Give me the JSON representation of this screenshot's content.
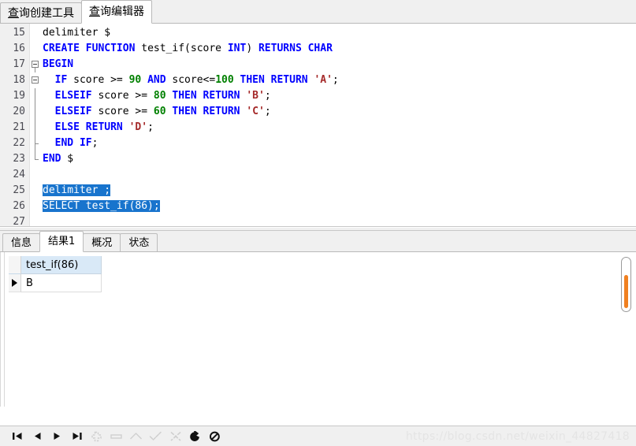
{
  "top_tabs": [
    {
      "label": "查询创建工具",
      "mnemonic": "查",
      "rest": "询创建工具",
      "active": false
    },
    {
      "label": "查询编辑器",
      "mnemonic": "查",
      "rest": "询编辑器",
      "active": true
    }
  ],
  "editor": {
    "first_line_number": 15,
    "lines": [
      {
        "n": "15",
        "fold": "none",
        "text": "delimiter $"
      },
      {
        "n": "16",
        "fold": "none",
        "text": "CREATE FUNCTION test_if(score INT) RETURNS CHAR"
      },
      {
        "n": "17",
        "fold": "open",
        "text": "BEGIN"
      },
      {
        "n": "18",
        "fold": "open2",
        "text": "  IF score >= 90 AND score<=100 THEN RETURN 'A';"
      },
      {
        "n": "19",
        "fold": "bar",
        "text": "  ELSEIF score >= 80 THEN RETURN 'B';"
      },
      {
        "n": "20",
        "fold": "bar",
        "text": "  ELSEIF score >= 60 THEN RETURN 'C';"
      },
      {
        "n": "21",
        "fold": "bar",
        "text": "  ELSE RETURN 'D';"
      },
      {
        "n": "22",
        "fold": "endin",
        "text": "  END IF;"
      },
      {
        "n": "23",
        "fold": "end",
        "text": "END $"
      },
      {
        "n": "24",
        "fold": "none",
        "text": ""
      },
      {
        "n": "25",
        "fold": "none",
        "text": "delimiter ;",
        "selected": true
      },
      {
        "n": "26",
        "fold": "none",
        "text": "SELECT test_if(86);",
        "selected": true
      },
      {
        "n": "27",
        "fold": "none",
        "text": ""
      }
    ],
    "selection_color": "#1874cd",
    "keyword_color": "#0000ff",
    "number_color": "#008000",
    "string_color": "#a52a2a"
  },
  "result_tabs": [
    {
      "label": "信息",
      "active": false
    },
    {
      "label": "结果1",
      "active": true
    },
    {
      "label": "概况",
      "active": false
    },
    {
      "label": "状态",
      "active": false
    }
  ],
  "result_grid": {
    "columns": [
      "test_if(86)"
    ],
    "rows": [
      [
        "B"
      ]
    ],
    "current_row_marker": "▶",
    "header_bg": "#d9e9f7"
  },
  "scrollbar": {
    "thumb_color": "#f08020"
  },
  "nav_toolbar": {
    "buttons": [
      {
        "name": "first-record-button",
        "icon": "first-record-icon",
        "enabled": true
      },
      {
        "name": "prev-record-button",
        "icon": "prev-record-icon",
        "enabled": true
      },
      {
        "name": "next-record-button",
        "icon": "next-record-icon",
        "enabled": true
      },
      {
        "name": "last-record-button",
        "icon": "last-record-icon",
        "enabled": true
      },
      {
        "name": "insert-record-button",
        "icon": "plus-icon",
        "enabled": false
      },
      {
        "name": "delete-record-button",
        "icon": "minus-icon",
        "enabled": false
      },
      {
        "name": "edit-record-button",
        "icon": "caret-up-icon",
        "enabled": false
      },
      {
        "name": "apply-change-button",
        "icon": "check-icon",
        "enabled": false
      },
      {
        "name": "cancel-change-button",
        "icon": "cross-scissors-icon",
        "enabled": false
      },
      {
        "name": "refresh-button",
        "icon": "refresh-icon",
        "enabled": true
      },
      {
        "name": "stop-button",
        "icon": "stop-icon",
        "enabled": true
      }
    ]
  },
  "watermark": "https://blog.csdn.net/weixin_44827418"
}
